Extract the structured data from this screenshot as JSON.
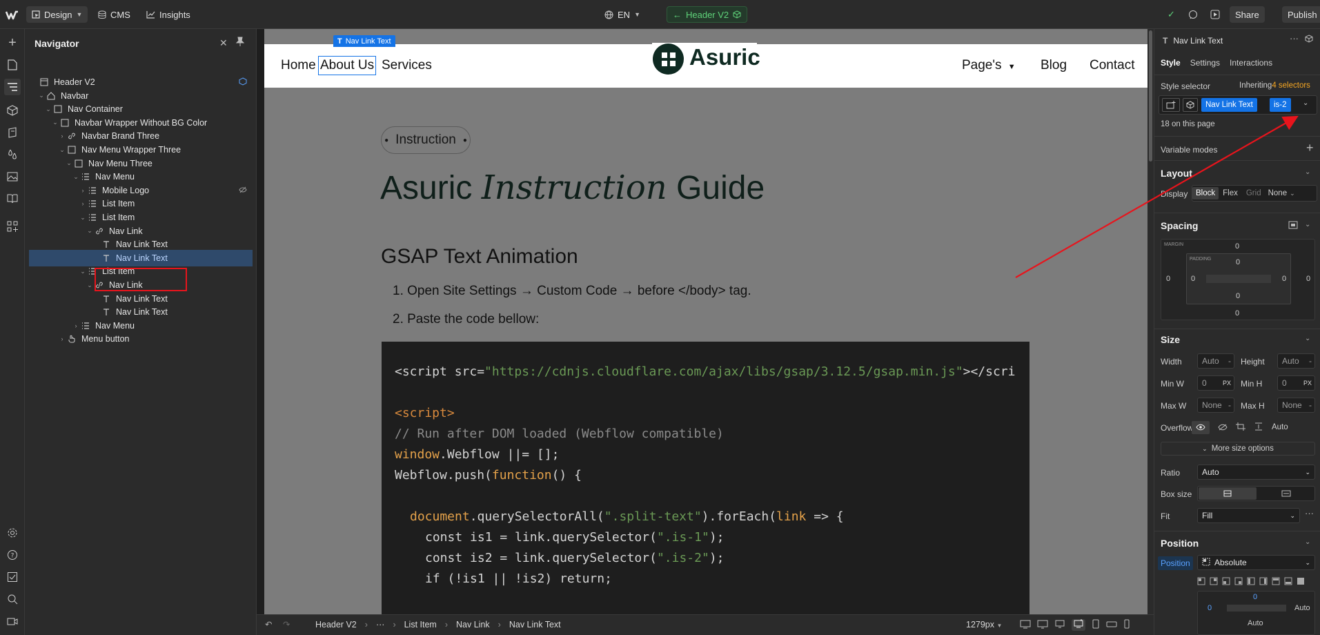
{
  "topbar": {
    "mode_label": "Design",
    "cms_label": "CMS",
    "insights_label": "Insights",
    "locale_label": "EN",
    "component_label": "Header V2",
    "share_label": "Share",
    "publish_label": "Publish"
  },
  "navigator": {
    "title": "Navigator",
    "tree": [
      {
        "label": "Header V2"
      },
      {
        "label": "Navbar"
      },
      {
        "label": "Nav Container"
      },
      {
        "label": "Navbar Wrapper Without BG Color"
      },
      {
        "label": "Navbar Brand Three"
      },
      {
        "label": "Nav Menu Wrapper Three"
      },
      {
        "label": "Nav Menu Three"
      },
      {
        "label": "Nav Menu"
      },
      {
        "label": "Mobile Logo"
      },
      {
        "label": "List Item"
      },
      {
        "label": "List Item"
      },
      {
        "label": "Nav Link"
      },
      {
        "label": "Nav Link Text"
      },
      {
        "label": "Nav Link Text"
      },
      {
        "label": "List Item"
      },
      {
        "label": "Nav Link"
      },
      {
        "label": "Nav Link Text"
      },
      {
        "label": "Nav Link Text"
      },
      {
        "label": "Nav Menu"
      },
      {
        "label": "Menu button"
      }
    ]
  },
  "canvas": {
    "selected_tag": "Nav Link Text",
    "nav": {
      "home": "Home",
      "about": "About Us",
      "services": "Services",
      "brand": "Asuric",
      "pages": "Page's",
      "blog": "Blog",
      "contact": "Contact"
    },
    "badge": "Instruction",
    "heading_a": "Asuric",
    "heading_b": "Instruction",
    "heading_c": "Guide",
    "subheading": "GSAP Text Animation",
    "steps": [
      "Open Site Settings → Custom Code →  before </body> tag.",
      "Paste the code bellow:"
    ],
    "code": {
      "l1a": "<script src=",
      "l1b": "\"https://cdnjs.cloudflare.com/ajax/libs/gsap/3.12.5/gsap.min.js\"",
      "l1c": "></scri",
      "l2": "<script>",
      "l3": "// Run after DOM loaded (Webflow compatible)",
      "l4a": "window",
      "l4b": ".Webflow ||= [];",
      "l5a": "Webflow.push(",
      "l5b": "function",
      "l5c": "() {",
      "l6a": "document",
      "l6b": ".querySelectorAll(",
      "l6c": "\".split-text\"",
      "l6d": ").forEach(",
      "l6e": "link",
      "l6f": " => {",
      "l7a": "const is1 = link.querySelector(",
      "l7b": "\".is-1\"",
      "l7c": ");",
      "l8a": "const is2 = link.querySelector(",
      "l8b": "\".is-2\"",
      "l8c": ");",
      "l9": "if (!is1 || !is2) return;"
    }
  },
  "bottombar": {
    "crumbs": [
      "Header V2",
      "···",
      "List Item",
      "Nav Link",
      "Nav Link Text"
    ],
    "width_label": "1279px"
  },
  "rightpanel": {
    "element_title": "Nav Link Text",
    "tabs": [
      "Style",
      "Settings",
      "Interactions"
    ],
    "style_selector_label": "Style selector",
    "inheriting_label": "Inheriting",
    "selectors_count_label": "4 selectors",
    "chip_class": "Nav Link Text",
    "chip_combo": "is-2",
    "on_page": "18 on this page",
    "variable_modes": "Variable modes",
    "layout_title": "Layout",
    "display_label": "Display",
    "display_options": [
      "Block",
      "Flex",
      "Grid",
      "None"
    ],
    "spacing_title": "Spacing",
    "margin_label": "MARGIN",
    "padding_label": "PADDING",
    "spacing_values": {
      "margin_top": "0",
      "margin_left": "0",
      "margin_right": "0",
      "margin_bottom": "0",
      "padding_top": "0",
      "padding_left": "0",
      "padding_right": "0",
      "padding_bottom": "0"
    },
    "size_title": "Size",
    "width_label": "Width",
    "width_value": "Auto",
    "height_label": "Height",
    "height_value": "Auto",
    "minw_label": "Min W",
    "minw_value": "0",
    "minh_label": "Min H",
    "minh_value": "0",
    "unit_px": "PX",
    "maxw_label": "Max W",
    "maxw_value": "None",
    "maxh_label": "Max H",
    "maxh_value": "None",
    "overflow_label": "Overflow",
    "overflow_auto": "Auto",
    "more_size": "More size options",
    "ratio_label": "Ratio",
    "ratio_value": "Auto",
    "boxsize_label": "Box size",
    "fit_label": "Fit",
    "fit_value": "Fill",
    "position_title": "Position",
    "position_label": "Position",
    "position_value": "Absolute",
    "pos_top": "0",
    "pos_left": "0",
    "pos_right": "Auto",
    "pos_bottom": "Auto"
  },
  "colors": {
    "accent_blue": "#1473e6",
    "selection_red": "#e8141c",
    "component_green": "#4cd964",
    "inheriting_orange": "#f5a623",
    "code_string": "#6a9955",
    "code_keyword": "#e5a24a"
  }
}
